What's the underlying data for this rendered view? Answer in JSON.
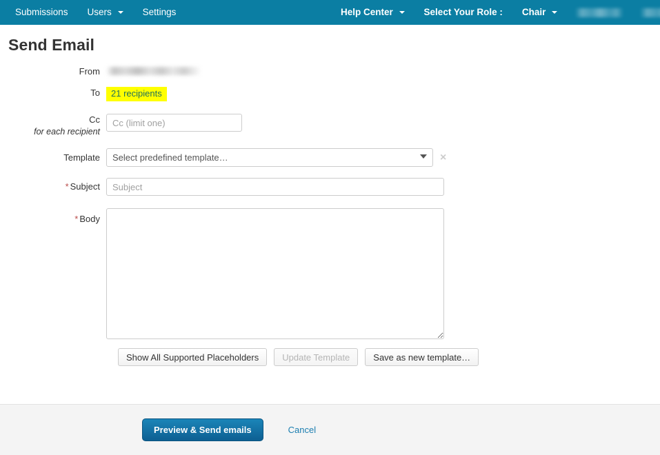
{
  "navbar": {
    "background_color": "#0b7ea3",
    "left_items": [
      {
        "label": "Submissions",
        "has_caret": false
      },
      {
        "label": "Users",
        "has_caret": true
      },
      {
        "label": "Settings",
        "has_caret": false
      }
    ],
    "right_items": [
      {
        "label": "Help Center",
        "has_caret": true
      },
      {
        "label": "Select Your Role :",
        "has_caret": false
      },
      {
        "label": "Chair",
        "has_caret": true
      }
    ],
    "redacted_items": [
      "",
      ""
    ]
  },
  "page": {
    "title": "Send Email"
  },
  "form": {
    "from": {
      "label": "From",
      "value_redacted": ""
    },
    "to": {
      "label": "To",
      "recipients_text": "21 recipients",
      "highlight_color": "#ffff00",
      "link_color": "#1f6f5c"
    },
    "cc": {
      "label": "Cc",
      "sublabel": "for each recipient",
      "value": "",
      "placeholder": "Cc (limit one)"
    },
    "template": {
      "label": "Template",
      "selected": "Select predefined template…",
      "options": [
        "Select predefined template…"
      ],
      "clear_icon": "×"
    },
    "subject": {
      "label": "Subject",
      "required_marker": "*",
      "value": "",
      "placeholder": "Subject"
    },
    "body": {
      "label": "Body",
      "required_marker": "*",
      "value": "",
      "placeholder": ""
    }
  },
  "template_actions": {
    "show_placeholders": "Show All Supported Placeholders",
    "update_template": "Update Template",
    "save_as_new": "Save as new template…"
  },
  "footer": {
    "primary_button": "Preview & Send emails",
    "cancel_link": "Cancel",
    "background_color": "#f4f4f4",
    "primary_color": "#0d5f92"
  }
}
